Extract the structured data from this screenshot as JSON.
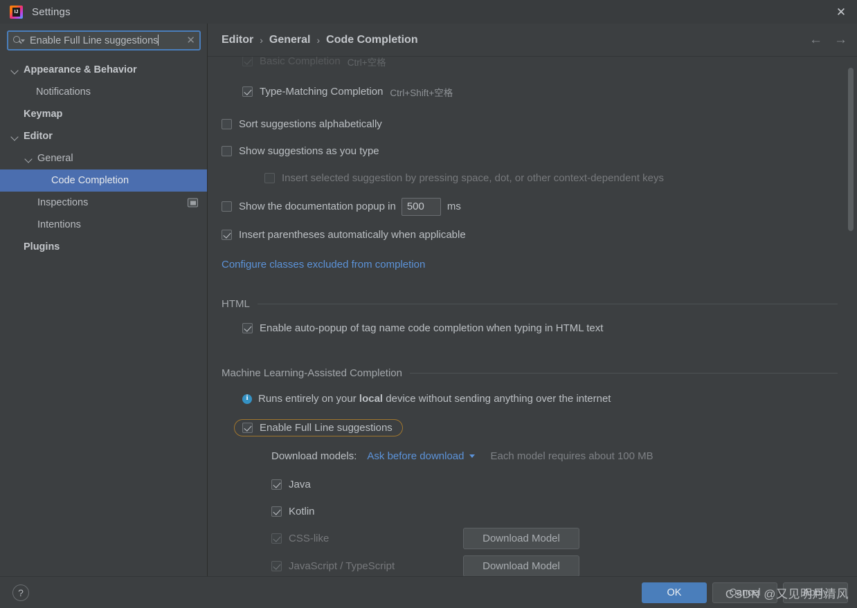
{
  "window": {
    "title": "Settings",
    "close_label": "✕",
    "app_icon": "intellij-idea-icon"
  },
  "search": {
    "value": "Enable Full Line suggestions",
    "placeholder": "Search settings",
    "clear_label": "✕"
  },
  "sidebar": {
    "items": [
      {
        "label": "Appearance & Behavior",
        "indent": 0,
        "expandable": true,
        "bold": true,
        "selected": false
      },
      {
        "label": "Notifications",
        "indent": 1,
        "expandable": false,
        "bold": false,
        "selected": false
      },
      {
        "label": "Keymap",
        "indent": 0,
        "expandable": false,
        "bold": true,
        "selected": false
      },
      {
        "label": "Editor",
        "indent": 0,
        "expandable": true,
        "bold": true,
        "selected": false
      },
      {
        "label": "General",
        "indent": 1,
        "expandable": true,
        "bold": false,
        "selected": false
      },
      {
        "label": "Code Completion",
        "indent": 2,
        "expandable": false,
        "bold": false,
        "selected": true
      },
      {
        "label": "Inspections",
        "indent": 1,
        "expandable": false,
        "bold": false,
        "selected": false,
        "badge": true
      },
      {
        "label": "Intentions",
        "indent": 1,
        "expandable": false,
        "bold": false,
        "selected": false
      },
      {
        "label": "Plugins",
        "indent": 0,
        "expandable": false,
        "bold": true,
        "selected": false
      }
    ]
  },
  "breadcrumb": {
    "parts": [
      "Editor",
      "General",
      "Code Completion"
    ],
    "separator": "›",
    "back_label": "←",
    "forward_label": "→"
  },
  "content": {
    "clipped_top_row": {
      "label": "Basic Completion",
      "shortcut": "Ctrl+空格",
      "checked": true
    },
    "rows": [
      {
        "label": "Type-Matching Completion",
        "shortcut": "Ctrl+Shift+空格",
        "checked": true,
        "indent": 1,
        "enabled": true
      },
      {
        "label": "Sort suggestions alphabetically",
        "shortcut": "",
        "checked": false,
        "indent": 0,
        "enabled": true
      },
      {
        "label": "Show suggestions as you type",
        "shortcut": "",
        "checked": false,
        "indent": 0,
        "enabled": true
      },
      {
        "label": "Insert selected suggestion by pressing space, dot, or other context-dependent keys",
        "shortcut": "",
        "checked": false,
        "indent": 2,
        "enabled": false
      }
    ],
    "doc_popup": {
      "label_before": "Show the documentation popup in",
      "value": "500",
      "label_after": "ms",
      "checked": false
    },
    "insert_parens": {
      "label": "Insert parentheses automatically when applicable",
      "checked": true
    },
    "excluded_link": "Configure classes excluded from completion",
    "html_section": {
      "title": "HTML",
      "row": {
        "label": "Enable auto-popup of tag name code completion when typing in HTML text",
        "checked": true
      }
    },
    "ml_section": {
      "title": "Machine Learning-Assisted Completion",
      "info_pre": "Runs entirely on your ",
      "info_bold": "local",
      "info_post": " device without sending anything over the internet",
      "enable_full_line": {
        "label": "Enable Full Line suggestions",
        "checked": true,
        "highlighted": true
      },
      "download_models_label": "Download models:",
      "download_models_value": "Ask before download",
      "download_models_note": "Each model requires about 100 MB",
      "models": [
        {
          "label": "Java",
          "checked": true,
          "enabled": true,
          "button": ""
        },
        {
          "label": "Kotlin",
          "checked": true,
          "enabled": true,
          "button": ""
        },
        {
          "label": "CSS-like",
          "checked": true,
          "enabled": false,
          "button": "Download Model"
        },
        {
          "label": "JavaScript / TypeScript",
          "checked": true,
          "enabled": false,
          "button": "Download Model"
        }
      ]
    }
  },
  "footer": {
    "help_label": "?",
    "ok_label": "OK",
    "cancel_label": "Cancel",
    "apply_label": "Apply",
    "watermark": "CSDN @又见明月清风"
  },
  "colors": {
    "background": "#3c3f41",
    "selection": "#4b6eaf",
    "accent_link": "#5c93d9",
    "highlight_border": "#a1772e",
    "primary_button": "#4a7ebb",
    "info_icon": "#3592c4"
  }
}
